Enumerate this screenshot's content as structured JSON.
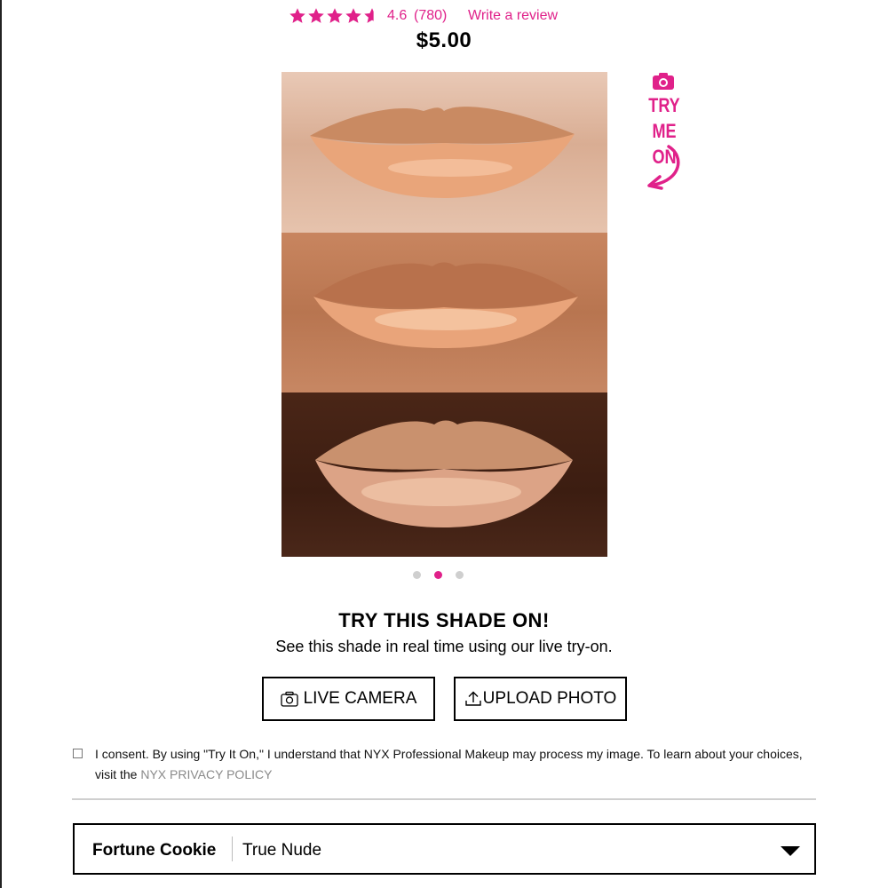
{
  "rating": {
    "value": "4.6",
    "count": "(780)",
    "stars": 4.6,
    "write_review": "Write a review"
  },
  "price": "$5.00",
  "try_me_on": {
    "line1": "TRY",
    "line2": "ME ON"
  },
  "carousel": {
    "total": 3,
    "active": 2
  },
  "try_shade": {
    "title": "TRY THIS SHADE ON!",
    "subtitle": "See this shade in real time using our live try-on.",
    "live_camera": "LIVE CAMERA",
    "upload_photo": "UPLOAD PHOTO"
  },
  "consent": {
    "text": "I consent. By using \"Try It On,\" I understand that NYX Professional Makeup may process my image. To learn about your choices, visit the ",
    "link": "NYX PRIVACY POLICY"
  },
  "shade_select": {
    "name": "Fortune Cookie",
    "description": "True Nude"
  },
  "colors": {
    "accent": "#e0218a",
    "dot_inactive": "#cfcfcf"
  }
}
